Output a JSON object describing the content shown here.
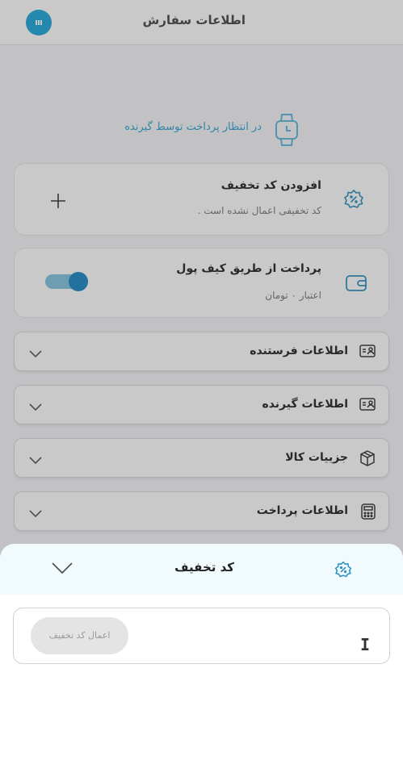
{
  "header": {
    "title": "اطلاعات سفارش",
    "badge_icon": "support-icon"
  },
  "status": {
    "text": "در انتظار پرداخت توسط گیرنده",
    "icon": "watch-icon",
    "color": "#2aa2d4"
  },
  "discount_card": {
    "title": "افزودن کد تخفیف",
    "subtitle": "کد تخفیفی اعمال نشده است .",
    "icon": "discount-badge-icon",
    "action_icon": "plus-icon"
  },
  "wallet_card": {
    "title": "پرداخت از طریق کیف پول",
    "subtitle": "اعتبار ۰ تومان",
    "icon": "wallet-icon",
    "toggle_on": true
  },
  "sections": [
    {
      "label": "اطلاعات فرستنده",
      "icon": "id-card-icon"
    },
    {
      "label": "اطلاعات گیرنده",
      "icon": "id-card-icon"
    },
    {
      "label": "جزییات کالا",
      "icon": "box-icon"
    },
    {
      "label": "اطلاعات پرداخت",
      "icon": "calculator-icon"
    }
  ],
  "sheet": {
    "title": "کد تخفیف",
    "icon": "discount-badge-icon",
    "close_icon": "chevron-down-icon",
    "input_value": "",
    "apply_label": "اعمال کد تخفیف"
  },
  "colors": {
    "accent": "#1ba4d8",
    "sheet_header_bg": "#f1fafd"
  }
}
